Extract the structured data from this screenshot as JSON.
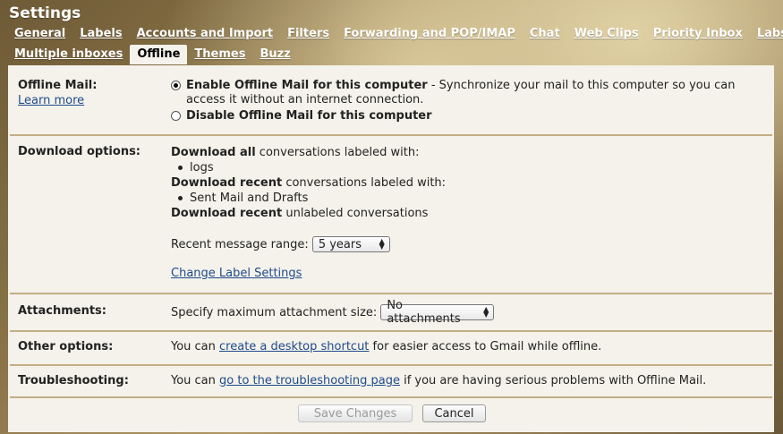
{
  "header": {
    "title": "Settings"
  },
  "tabs_row1": [
    {
      "label": "General"
    },
    {
      "label": "Labels"
    },
    {
      "label": "Accounts and Import"
    },
    {
      "label": "Filters"
    },
    {
      "label": "Forwarding and POP/IMAP"
    },
    {
      "label": "Chat"
    },
    {
      "label": "Web Clips"
    },
    {
      "label": "Priority Inbox"
    },
    {
      "label": "Labs"
    }
  ],
  "tabs_row2": [
    {
      "label": "Multiple inboxes"
    },
    {
      "label": "Offline",
      "active": true
    },
    {
      "label": "Themes"
    },
    {
      "label": "Buzz"
    }
  ],
  "offline_mail": {
    "label": "Offline Mail:",
    "learn_more": "Learn more",
    "enable_label": "Enable Offline Mail for this computer",
    "enable_desc": " - Synchronize your mail to this computer so you can access it without an internet connection.",
    "disable_label": "Disable Offline Mail for this computer",
    "selected": "enable"
  },
  "download_options": {
    "label": "Download options:",
    "all_bold": "Download all",
    "all_rest": " conversations labeled with:",
    "all_labels": [
      "logs"
    ],
    "recent_bold": "Download recent",
    "recent_rest": " conversations labeled with:",
    "recent_labels": [
      "Sent Mail and Drafts"
    ],
    "unlabeled_bold": "Download recent",
    "unlabeled_rest": " unlabeled conversations",
    "range_label": "Recent message range:",
    "range_value": "5 years",
    "change_link": "Change Label Settings"
  },
  "attachments": {
    "label": "Attachments:",
    "text": "Specify maximum attachment size:",
    "value": "No attachments"
  },
  "other_options": {
    "label": "Other options:",
    "pre": "You can ",
    "link": "create a desktop shortcut",
    "post": " for easier access to Gmail while offline."
  },
  "troubleshooting": {
    "label": "Troubleshooting:",
    "pre": "You can ",
    "link": "go to the troubleshooting page",
    "post": " if you are having serious problems with Offline Mail."
  },
  "buttons": {
    "save": "Save Changes",
    "cancel": "Cancel"
  }
}
